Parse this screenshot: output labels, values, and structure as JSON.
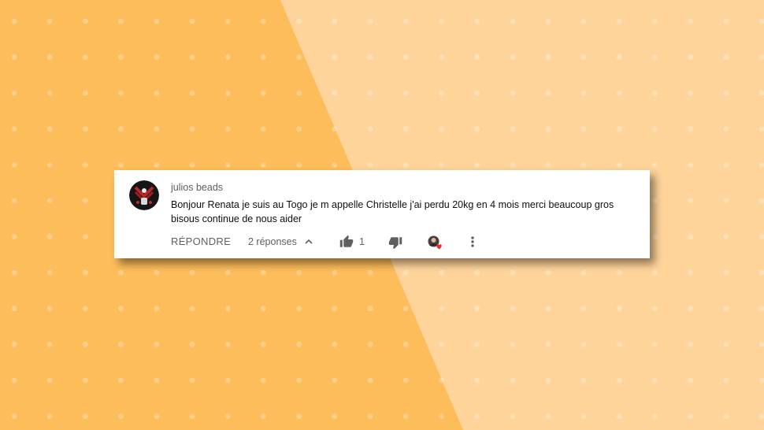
{
  "comment": {
    "author": "julios beads",
    "text": "Bonjour Renata je suis au Togo je m appelle Christelle j'ai perdu 20kg en 4 mois merci beaucoup gros bisous continue de nous aider",
    "reply_label": "RÉPONDRE",
    "replies_label": "2 réponses",
    "like_count": "1"
  },
  "icons": {
    "avatar": "avatar",
    "replies_toggle": "chevron-up-icon",
    "like": "thumbs-up-icon",
    "dislike": "thumbs-down-icon",
    "creator_heart": "creator-heart-icon",
    "menu": "more-vertical-icon"
  },
  "colors": {
    "bg_left": "#fdbd5b",
    "bg_right": "#ffd49b",
    "card": "#ffffff",
    "meta_text": "#606060",
    "heart": "#e52d27"
  }
}
